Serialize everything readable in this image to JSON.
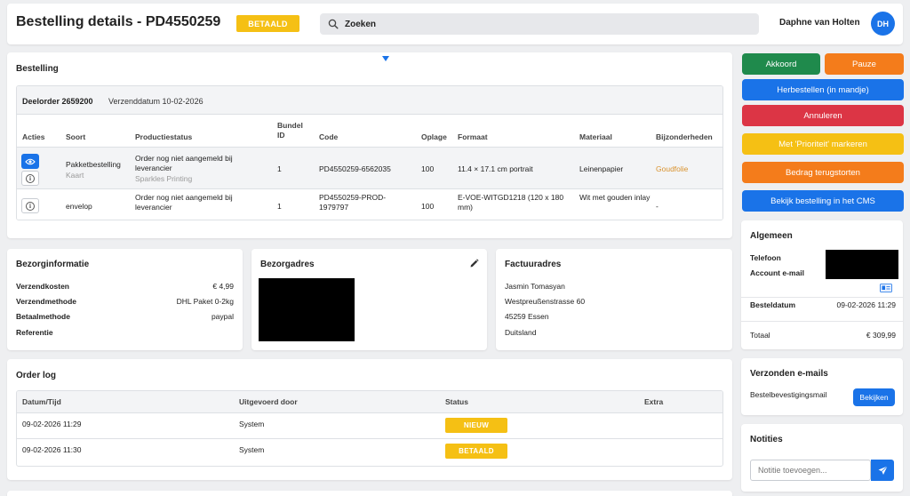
{
  "header": {
    "title": "Bestelling details - PD4550259",
    "status_badge": "BETAALD",
    "search_placeholder": "Zoeken",
    "user_name": "Daphne van Holten",
    "user_initials": "DH"
  },
  "order": {
    "title": "Bestelling",
    "suborder_label": "Deelorder 2659200",
    "ship_date": "Verzenddatum 10-02-2026",
    "columns": [
      "Acties",
      "Soort",
      "Productiestatus",
      "Bundel ID",
      "Code",
      "Oplage",
      "Formaat",
      "Materiaal",
      "Bijzonderheden"
    ],
    "rows": [
      {
        "soort": "Pakketbestelling",
        "soort_sub": "Kaart",
        "status": "Order nog niet aangemeld bij leverancier",
        "status_sub": "Sparkles Printing",
        "bundel": "1",
        "code": "PD4550259-6562035",
        "oplage": "100",
        "formaat": "11.4 × 17.1 cm portrait",
        "materiaal": "Leinenpapier",
        "bijzonderheden": "Goudfolie"
      },
      {
        "soort": "envelop",
        "soort_sub": "",
        "status": "Order nog niet aangemeld bij leverancier",
        "status_sub": "",
        "bundel": "1",
        "code": "PD4550259-PROD-1979797",
        "oplage": "100",
        "formaat": "E-VOE-WITGD1218 (120 x 180 mm)",
        "materiaal": "Wit met gouden inlay",
        "bijzonderheden": "-"
      }
    ]
  },
  "bezorg": {
    "title": "Bezorginformatie",
    "rows": [
      {
        "label": "Verzendkosten",
        "value": "€ 4,99"
      },
      {
        "label": "Verzendmethode",
        "value": "DHL Paket 0-2kg"
      },
      {
        "label": "Betaalmethode",
        "value": "paypal"
      },
      {
        "label": "Referentie",
        "value": ""
      }
    ]
  },
  "bezorgadres": {
    "title": "Bezorgadres"
  },
  "factuur": {
    "title": "Factuuradres",
    "lines": [
      "Jasmin Tomasyan",
      "Westpreußenstrasse 60",
      "45259 Essen",
      "Duitsland"
    ]
  },
  "log": {
    "title": "Order log",
    "columns": [
      "Datum/Tijd",
      "Uitgevoerd door",
      "Status",
      "Extra"
    ],
    "rows": [
      {
        "date": "09-02-2026 11:29",
        "by": "System",
        "status": "NIEUW",
        "extra": ""
      },
      {
        "date": "09-02-2026 11:30",
        "by": "System",
        "status": "BETAALD",
        "extra": ""
      }
    ]
  },
  "actions": {
    "akkoord": "Akkoord",
    "pauze": "Pauze",
    "herbestellen": "Herbestellen (in mandje)",
    "annuleren": "Annuleren",
    "prioriteit": "Met 'Prioriteit' markeren",
    "terugstorten": "Bedrag terugstorten",
    "cms": "Bekijk bestelling in het CMS"
  },
  "algemeen": {
    "title": "Algemeen",
    "telefoon_label": "Telefoon",
    "email_label": "Account e-mail",
    "besteldatum_label": "Besteldatum",
    "besteldatum_value": "09-02-2026 11:29",
    "totaal_label": "Totaal",
    "totaal_value": "€ 309,99"
  },
  "mails": {
    "title": "Verzonden e-mails",
    "item_label": "Bestelbevestigingsmail",
    "view_button": "Bekijken"
  },
  "notities": {
    "title": "Notities",
    "placeholder": "Notitie toevoegen..."
  },
  "colors": {
    "primary": "#1a73e8",
    "success": "#1f8a4c",
    "orange": "#f47c1b",
    "danger": "#dc3545",
    "warning": "#f5c014",
    "link_gold": "#d9922e"
  }
}
